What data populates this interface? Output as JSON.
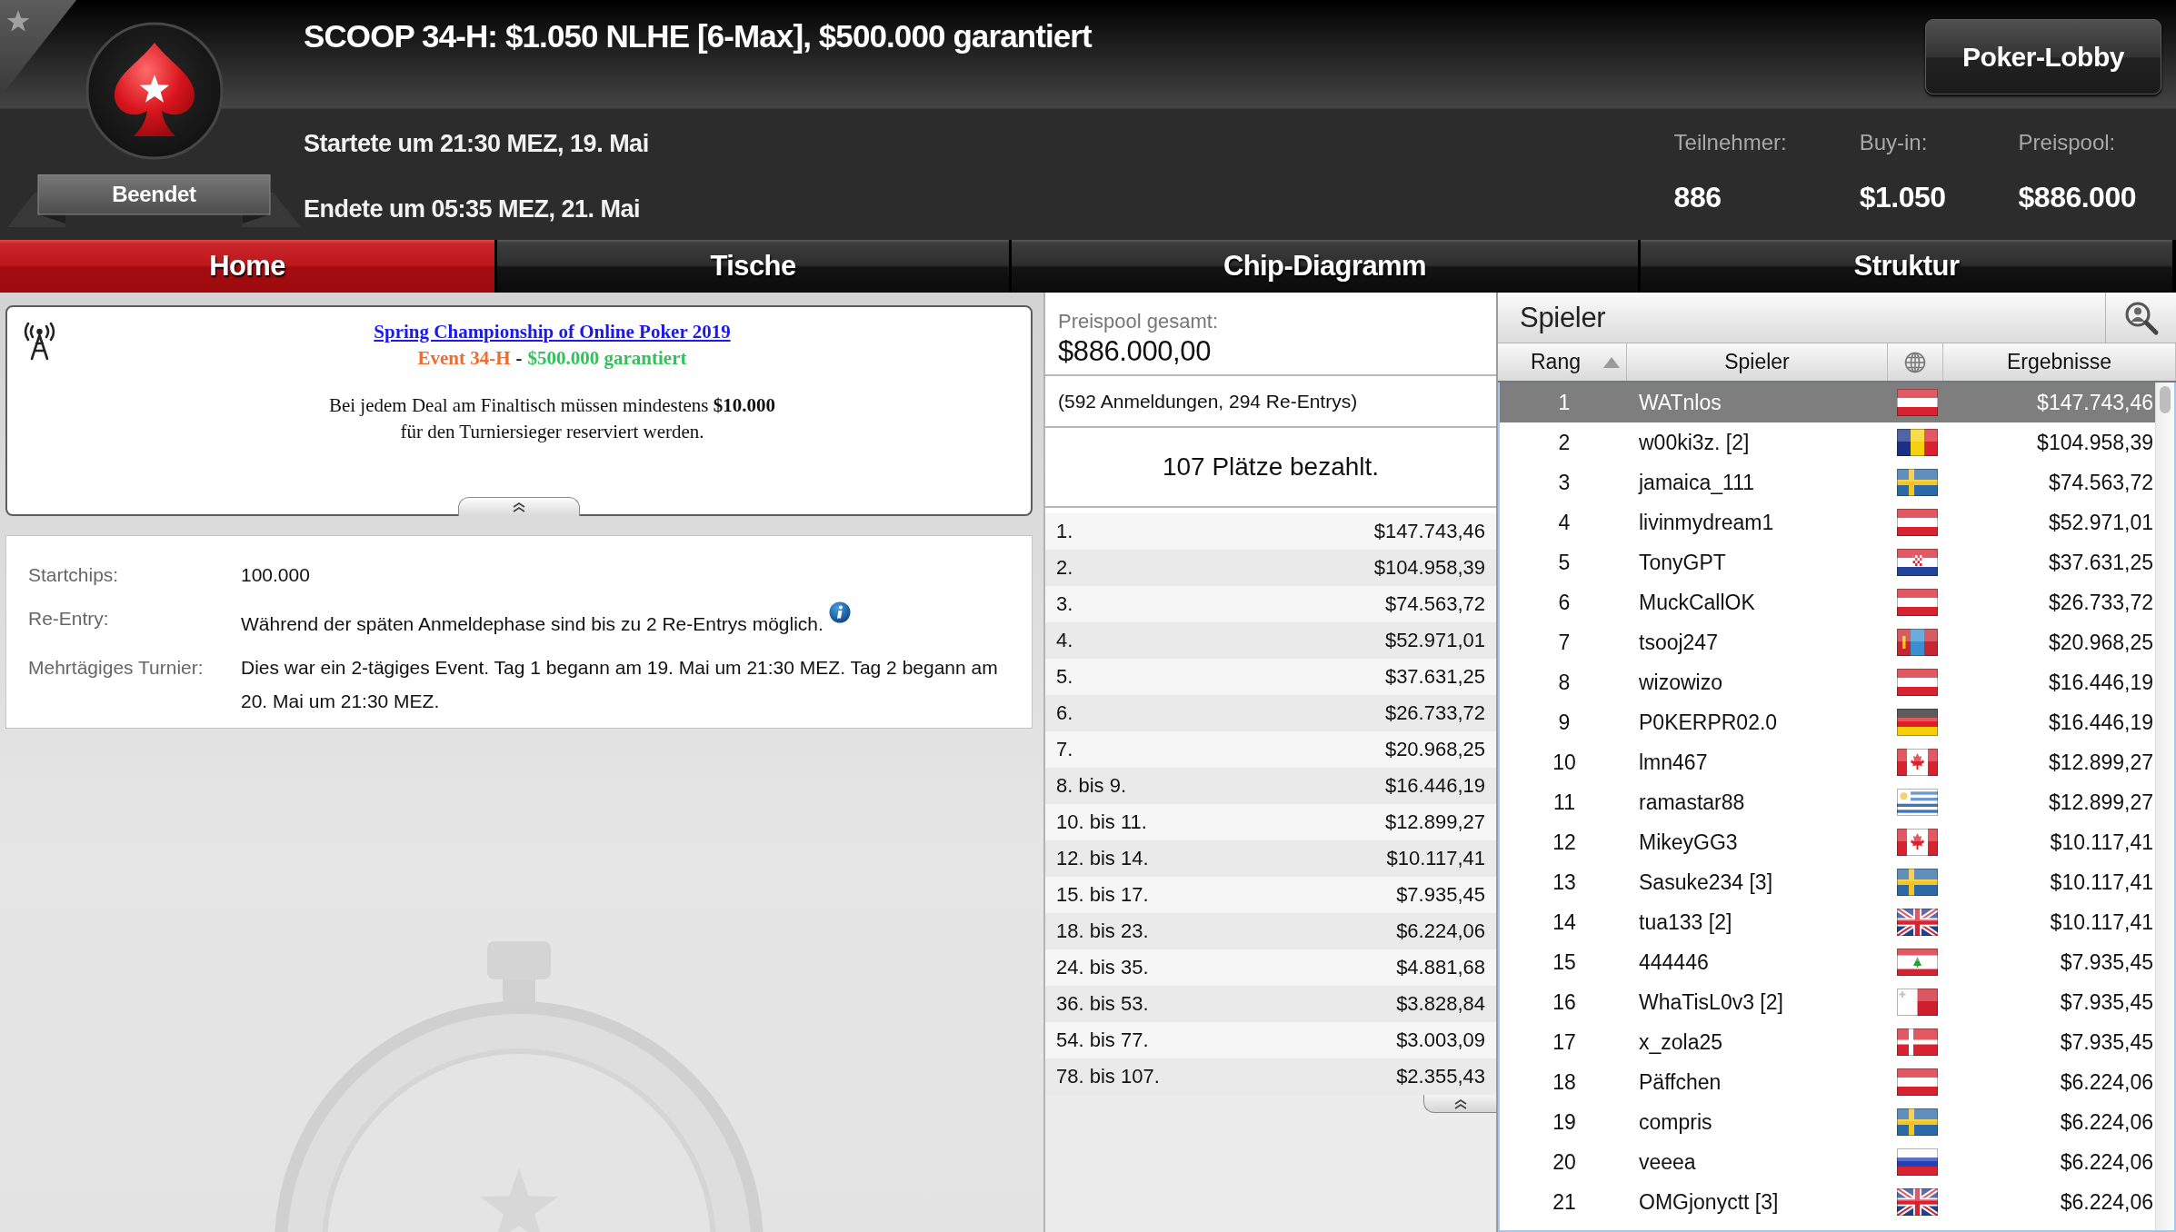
{
  "header": {
    "title": "SCOOP 34-H: $1.050 NLHE [6-Max], $500.000 garantiert",
    "status": "Beendet",
    "started": "Startete um 21:30 MEZ, 19. Mai",
    "ended": "Endete um 05:35 MEZ, 21. Mai",
    "lobby_button": "Poker-Lobby",
    "stats": [
      {
        "label": "Teilnehmer:",
        "value": "886"
      },
      {
        "label": "Buy-in:",
        "value": "$1.050"
      },
      {
        "label": "Preispool:",
        "value": "$886.000"
      }
    ]
  },
  "tabs": [
    {
      "label": "Home",
      "selected": true
    },
    {
      "label": "Tische",
      "selected": false
    },
    {
      "label": "Chip-Diagramm",
      "selected": false
    },
    {
      "label": "Struktur",
      "selected": false
    }
  ],
  "info": {
    "link": "Spring Championship of Online Poker 2019",
    "subtitle": [
      {
        "text": "Event 34-H",
        "color": "#f26b2e"
      },
      {
        "text": "-",
        "color": "#111111"
      },
      {
        "text": "$500.000 garantiert",
        "color": "#2fc457"
      }
    ],
    "notice": "Bei jedem Deal am Finaltisch müssen mindestens **$10.000** für den Turniersieger reserviert werden."
  },
  "details": [
    {
      "label": "Startchips:",
      "value": "100.000",
      "info": false
    },
    {
      "label": "Re-Entry:",
      "value": "Während der späten Anmeldephase sind bis zu 2 Re-Entrys möglich.",
      "info": true
    },
    {
      "label": "Mehrtägiges Turnier:",
      "value": "Dies war ein 2-tägiges Event. Tag 1 begann am 19. Mai um 21:30 MEZ. Tag 2 begann am 20. Mai um 21:30 MEZ.",
      "info": false
    }
  ],
  "prize_pool": {
    "label": "Preispool gesamt:",
    "value": "$886.000,00",
    "entries": "(592 Anmeldungen, 294 Re-Entrys)",
    "paid": "107 Plätze bezahlt.",
    "payouts": [
      {
        "place": "1.",
        "amount": "$147.743,46"
      },
      {
        "place": "2.",
        "amount": "$104.958,39"
      },
      {
        "place": "3.",
        "amount": "$74.563,72"
      },
      {
        "place": "4.",
        "amount": "$52.971,01"
      },
      {
        "place": "5.",
        "amount": "$37.631,25"
      },
      {
        "place": "6.",
        "amount": "$26.733,72"
      },
      {
        "place": "7.",
        "amount": "$20.968,25"
      },
      {
        "place": "8. bis 9.",
        "amount": "$16.446,19"
      },
      {
        "place": "10. bis 11.",
        "amount": "$12.899,27"
      },
      {
        "place": "12. bis 14.",
        "amount": "$10.117,41"
      },
      {
        "place": "15. bis 17.",
        "amount": "$7.935,45"
      },
      {
        "place": "18. bis 23.",
        "amount": "$6.224,06"
      },
      {
        "place": "24. bis 35.",
        "amount": "$4.881,68"
      },
      {
        "place": "36. bis 53.",
        "amount": "$3.828,84"
      },
      {
        "place": "54. bis 77.",
        "amount": "$3.003,09"
      },
      {
        "place": "78. bis 107.",
        "amount": "$2.355,43"
      }
    ]
  },
  "players": {
    "title": "Spieler",
    "columns": [
      {
        "kind": "text",
        "label": "Rang",
        "sorted": true
      },
      {
        "kind": "text",
        "label": "Spieler",
        "sorted": false
      },
      {
        "kind": "globe",
        "sorted": false
      },
      {
        "kind": "text",
        "label": "Ergebnisse",
        "sorted": false
      }
    ],
    "rows": [
      {
        "rank": "1",
        "name": "WATnlos",
        "flag": {
          "kind": "austria"
        },
        "result": "$147.743,46",
        "selected": true
      },
      {
        "rank": "2",
        "name": "w00ki3z. [2]",
        "flag": {
          "kind": "romania"
        },
        "result": "$104.958,39",
        "selected": false
      },
      {
        "rank": "3",
        "name": "jamaica_111",
        "flag": {
          "kind": "sweden"
        },
        "result": "$74.563,72",
        "selected": false
      },
      {
        "rank": "4",
        "name": "livinmydream1",
        "flag": {
          "kind": "austria"
        },
        "result": "$52.971,01",
        "selected": false
      },
      {
        "rank": "5",
        "name": "TonyGPT",
        "flag": {
          "kind": "croatia"
        },
        "result": "$37.631,25",
        "selected": false
      },
      {
        "rank": "6",
        "name": "MuckCallOK",
        "flag": {
          "kind": "austria"
        },
        "result": "$26.733,72",
        "selected": false
      },
      {
        "rank": "7",
        "name": "tsooj247",
        "flag": {
          "kind": "mongolia"
        },
        "result": "$20.968,25",
        "selected": false
      },
      {
        "rank": "8",
        "name": "wizowizo",
        "flag": {
          "kind": "austria"
        },
        "result": "$16.446,19",
        "selected": false
      },
      {
        "rank": "9",
        "name": "P0KERPR02.0",
        "flag": {
          "kind": "germany"
        },
        "result": "$16.446,19",
        "selected": false
      },
      {
        "rank": "10",
        "name": "lmn467",
        "flag": {
          "kind": "canada"
        },
        "result": "$12.899,27",
        "selected": false
      },
      {
        "rank": "11",
        "name": "ramastar88",
        "flag": {
          "kind": "uruguay"
        },
        "result": "$12.899,27",
        "selected": false
      },
      {
        "rank": "12",
        "name": "MikeyGG3",
        "flag": {
          "kind": "canada"
        },
        "result": "$10.117,41",
        "selected": false
      },
      {
        "rank": "13",
        "name": "Sasuke234 [3]",
        "flag": {
          "kind": "sweden"
        },
        "result": "$10.117,41",
        "selected": false
      },
      {
        "rank": "14",
        "name": "tua133 [2]",
        "flag": {
          "kind": "uk"
        },
        "result": "$10.117,41",
        "selected": false
      },
      {
        "rank": "15",
        "name": "444446",
        "flag": {
          "kind": "lebanon"
        },
        "result": "$7.935,45",
        "selected": false
      },
      {
        "rank": "16",
        "name": "WhaTisL0v3 [2]",
        "flag": {
          "kind": "malta"
        },
        "result": "$7.935,45",
        "selected": false
      },
      {
        "rank": "17",
        "name": "x_zola25",
        "flag": {
          "kind": "denmark"
        },
        "result": "$7.935,45",
        "selected": false
      },
      {
        "rank": "18",
        "name": "Päffchen",
        "flag": {
          "kind": "austria"
        },
        "result": "$6.224,06",
        "selected": false
      },
      {
        "rank": "19",
        "name": "compris",
        "flag": {
          "kind": "sweden"
        },
        "result": "$6.224,06",
        "selected": false
      },
      {
        "rank": "20",
        "name": "veeea",
        "flag": {
          "kind": "russia"
        },
        "result": "$6.224,06",
        "selected": false
      },
      {
        "rank": "21",
        "name": "OMGjonyctt [3]",
        "flag": {
          "kind": "uk"
        },
        "result": "$6.224,06",
        "selected": false
      }
    ]
  }
}
